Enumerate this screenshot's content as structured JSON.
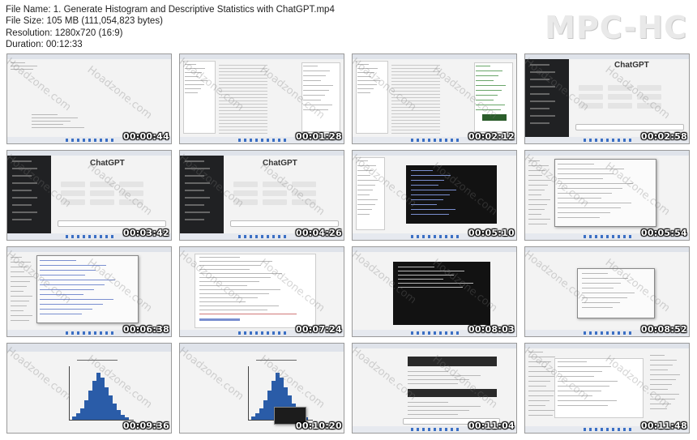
{
  "header": {
    "file_name": "File Name: 1. Generate Histogram and Descriptive Statistics with ChatGPT.mp4",
    "file_size": "File Size: 105 MB (111,054,823 bytes)",
    "resolution": "Resolution: 1280x720 (16:9)",
    "duration": "Duration: 00:12:33"
  },
  "logo": "MPC-HC",
  "watermark": "Hoadzone.com",
  "thumbnails": [
    {
      "timestamp": "00:00:44",
      "kind": "blank-editor"
    },
    {
      "timestamp": "00:01:28",
      "kind": "spreadsheet"
    },
    {
      "timestamp": "00:02:12",
      "kind": "spreadsheet-color"
    },
    {
      "timestamp": "00:02:58",
      "kind": "chatgpt",
      "title": "ChatGPT"
    },
    {
      "timestamp": "00:03:42",
      "kind": "chatgpt",
      "title": "ChatGPT"
    },
    {
      "timestamp": "00:04:26",
      "kind": "chatgpt",
      "title": "ChatGPT"
    },
    {
      "timestamp": "00:05:10",
      "kind": "terminal-code"
    },
    {
      "timestamp": "00:05:54",
      "kind": "dialogs"
    },
    {
      "timestamp": "00:06:38",
      "kind": "dialogs-2"
    },
    {
      "timestamp": "00:07:24",
      "kind": "code-editor"
    },
    {
      "timestamp": "00:08:03",
      "kind": "terminal-dark"
    },
    {
      "timestamp": "00:08:52",
      "kind": "small-dialog"
    },
    {
      "timestamp": "00:09:36",
      "kind": "histogram"
    },
    {
      "timestamp": "00:10:20",
      "kind": "histogram-popup"
    },
    {
      "timestamp": "00:11:04",
      "kind": "chat-code"
    },
    {
      "timestamp": "00:11:48",
      "kind": "notes"
    }
  ]
}
